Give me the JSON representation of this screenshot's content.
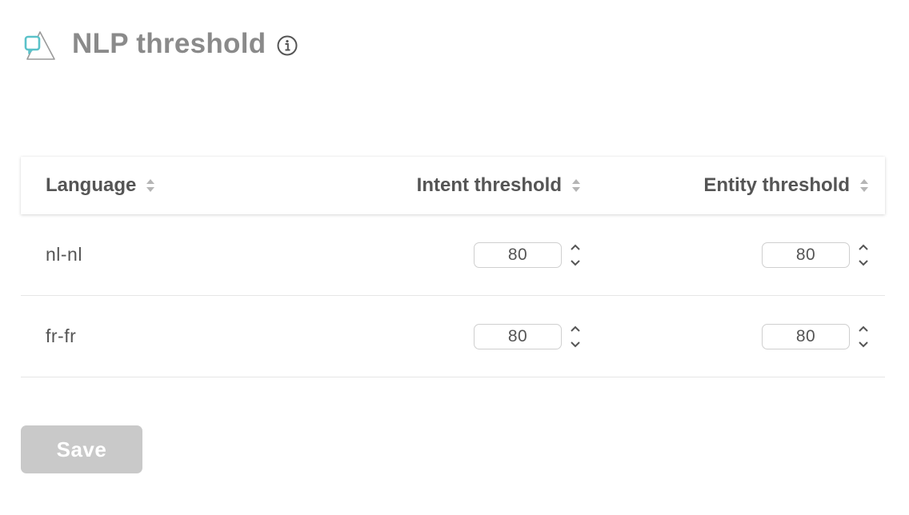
{
  "header": {
    "title": "NLP threshold",
    "logo_icon": "chat-bubble-triangle-logo-icon",
    "info_icon": "info-circle-icon"
  },
  "table": {
    "columns": [
      {
        "label": "Language",
        "sort_icon": "sort-arrows-icon"
      },
      {
        "label": "Intent threshold",
        "sort_icon": "sort-arrows-icon"
      },
      {
        "label": "Entity threshold",
        "sort_icon": "sort-arrows-icon"
      }
    ],
    "rows": [
      {
        "language": "nl-nl",
        "intent": "80",
        "entity": "80"
      },
      {
        "language": "fr-fr",
        "intent": "80",
        "entity": "80"
      }
    ]
  },
  "actions": {
    "save_label": "Save"
  },
  "colors": {
    "accent": "#5bc2c9",
    "title": "#8a8a8a",
    "text": "#555555",
    "button_disabled": "#c9c9c9"
  }
}
